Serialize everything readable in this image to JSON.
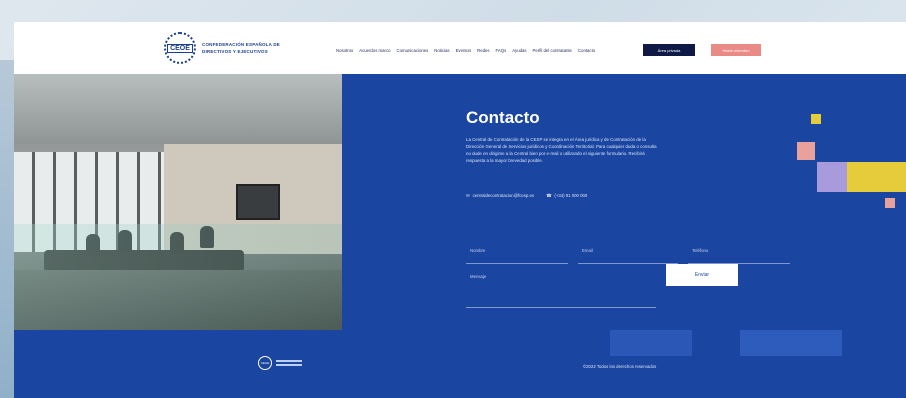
{
  "header": {
    "logo_badge": "CEOE",
    "logo_line1": "CONFEDERACIÓN ESPAÑOLA DE",
    "logo_line2": "DIRECTIVOS Y EJECUTIVOS",
    "nav": [
      "Nosotros",
      "Acuerdos marco",
      "Comunicaciones",
      "Noticias",
      "Eventos",
      "Redes",
      "FAQs",
      "Ayudas",
      "Perfil del contratante",
      "Contacto"
    ],
    "btn_dark": "Área privada",
    "btn_pink": "Hazte miembro"
  },
  "contact": {
    "title": "Contacto",
    "paragraph": "La Central de Contratación de la CESP se integra en el Área jurídica y de Contratación de la Dirección General de Servicios jurídicos y Coordinación Territorial. Para cualquier duda o consulta no dude en dirigirse a la Central bien por e-mail o utilizando el siguiente formulario. Recibirá respuesta a la mayor brevedad posible.",
    "email": "centraldecontratacion@fcesp.es",
    "phone": "(+34) 91 000 000",
    "fields": {
      "name": "Nombre",
      "email": "Email",
      "phone": "Teléfono",
      "message": "Mensaje"
    },
    "send_label": "Enviar"
  },
  "footer": {
    "copyright": "©2022 Todos los derechos reservados"
  },
  "colors": {
    "primary_blue": "#1a45a0",
    "dark_navy": "#0e1a45",
    "pink": "#e98a86",
    "yellow": "#e6cc3a",
    "lavender": "#a79bdc"
  }
}
